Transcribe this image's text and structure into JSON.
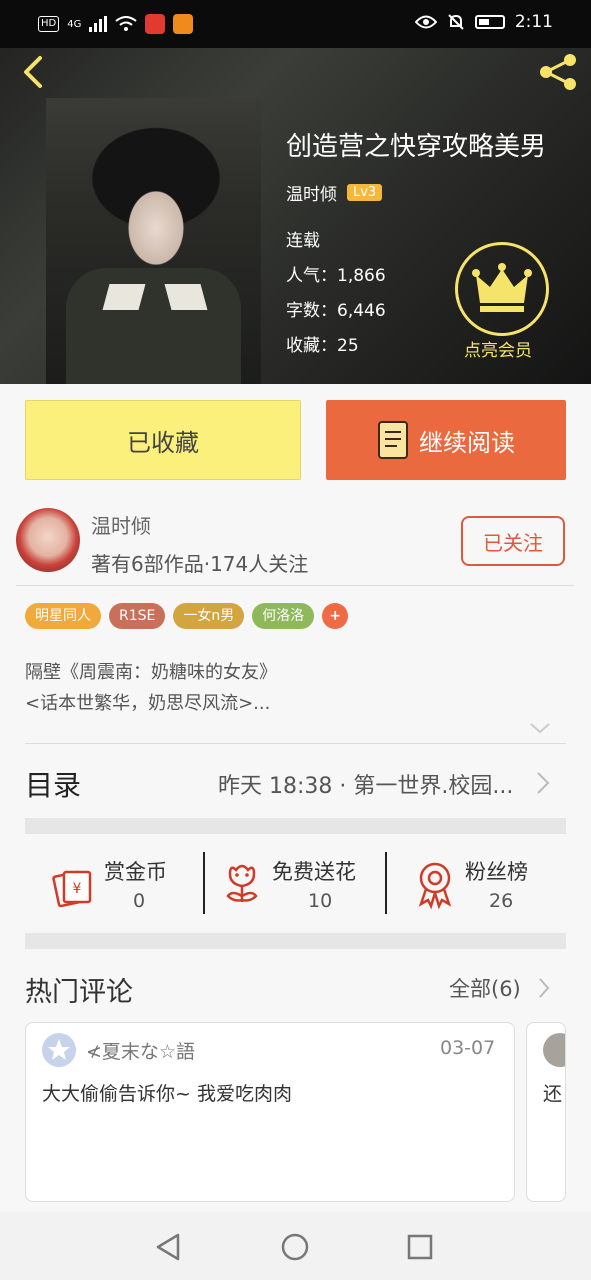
{
  "status_bar": {
    "left_labels": [
      "HD",
      "4G"
    ],
    "time": "2:11"
  },
  "book": {
    "title": "创造营之快穿攻略美男",
    "author": "温时倾",
    "level": "Lv3",
    "status": "连载",
    "popularity": "人气：1,866",
    "word_count": "字数：6,446",
    "favorites": "收藏：25",
    "vip_label": "点亮会员"
  },
  "actions": {
    "collected_label": "已收藏",
    "continue_label": "继续阅读"
  },
  "author_info": {
    "name": "温时倾",
    "stats": "著有6部作品·174人关注",
    "follow_label": "已关注"
  },
  "tags": [
    {
      "label": "明星同人",
      "color": "#f2a93b"
    },
    {
      "label": "R1SE",
      "color": "#c8705a"
    },
    {
      "label": "一女n男",
      "color": "#d3a541"
    },
    {
      "label": "何洛洛",
      "color": "#8eb85a"
    },
    {
      "label": "+",
      "color": "#ee6b45"
    }
  ],
  "description": {
    "line1": "隔壁《周震南：奶糖味的女友》",
    "line2": "<话本世繁华，奶思尽风流>..."
  },
  "toc": {
    "title": "目录",
    "latest": "昨天 18:38 · 第一世界.校园..."
  },
  "stats": [
    {
      "label": "赏金币",
      "value": "0",
      "icon": "gold-coin-icon"
    },
    {
      "label": "免费送花",
      "value": "10",
      "icon": "flower-icon"
    },
    {
      "label": "粉丝榜",
      "value": "26",
      "icon": "medal-icon"
    }
  ],
  "comments": {
    "title": "热门评论",
    "all_label": "全部(6)",
    "items": [
      {
        "user": "≮夏末な☆語",
        "date": "03-07",
        "text": "大大偷偷告诉你~ 我爱吃肉肉"
      },
      {
        "text": "还"
      }
    ]
  },
  "colors": {
    "accent_orange": "#ea693f",
    "collected_yellow": "#fbf07c",
    "vip_gold": "#f6e36a",
    "level_badge": "#f4b93a"
  }
}
